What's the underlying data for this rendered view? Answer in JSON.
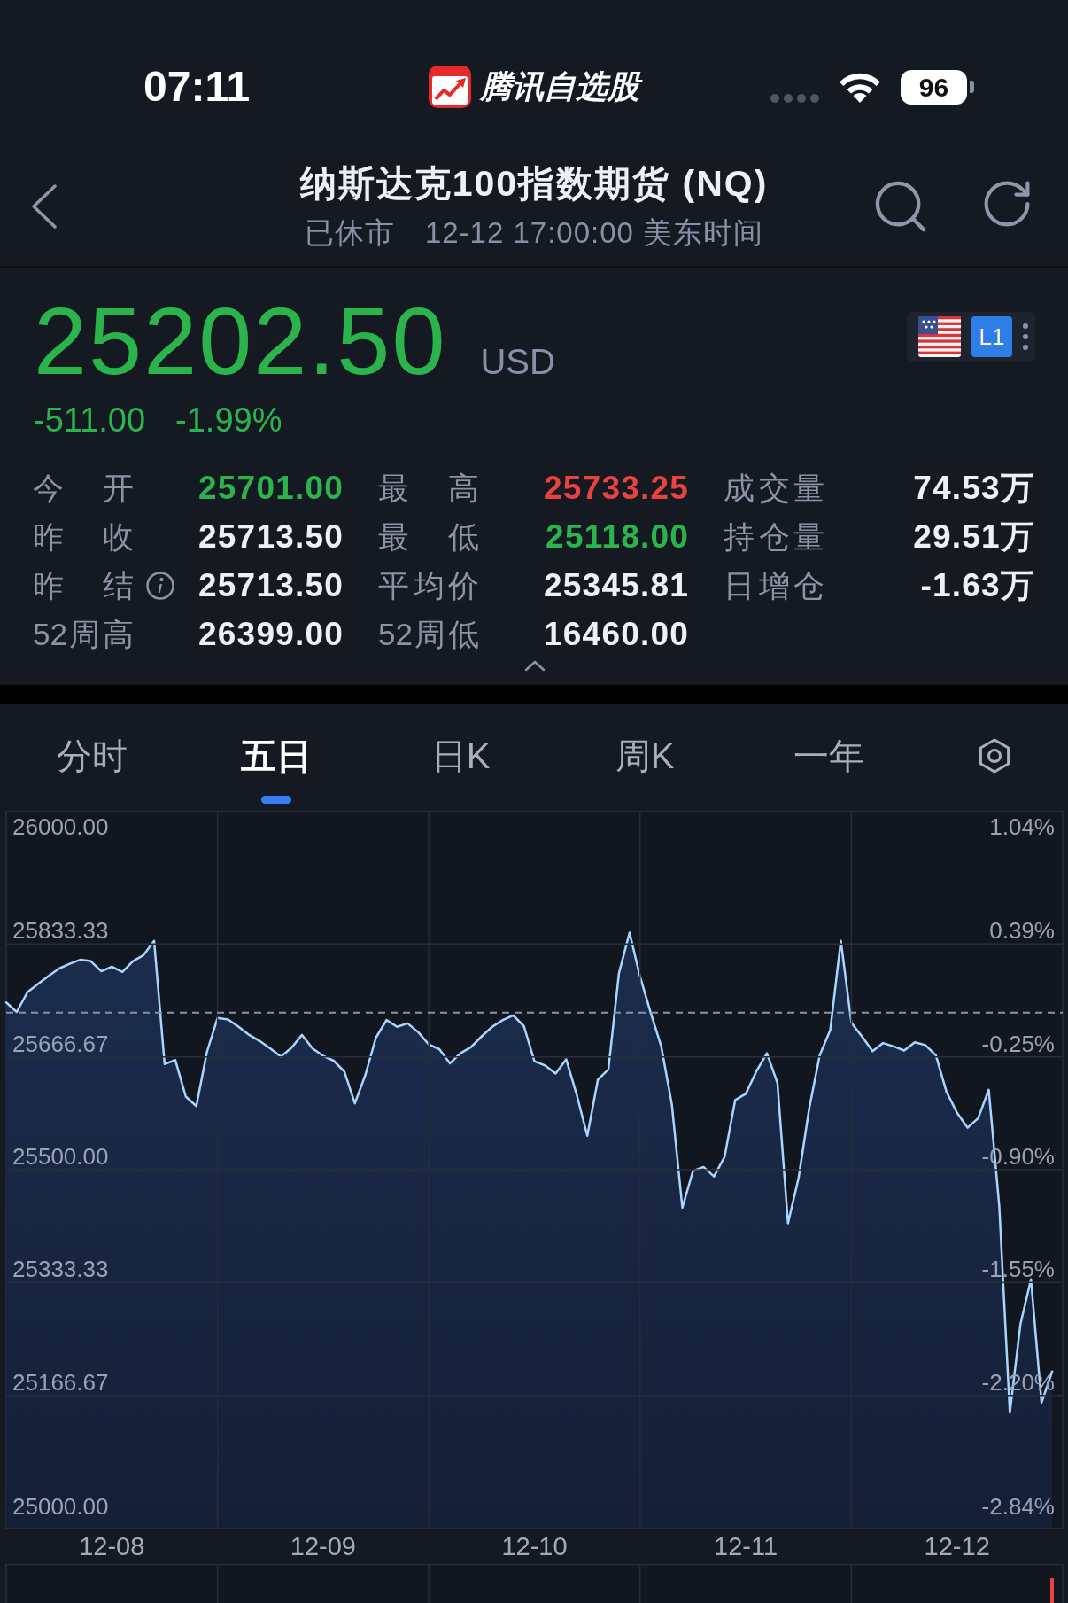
{
  "status_bar": {
    "time": "07:11",
    "app_name": "腾讯自选股",
    "battery": "96"
  },
  "header": {
    "title": "纳斯达克100指数期货 (NQ)",
    "market_status": "已休市",
    "timestamp": "12-12 17:00:00 美东时间"
  },
  "quote": {
    "price": "25202.50",
    "currency": "USD",
    "change": "-511.00",
    "change_percent": "-1.99%",
    "color": "#2cb44c",
    "level_badge": "L1"
  },
  "stats": [
    {
      "label": "今 开",
      "value": "25701.00",
      "color": "#2cb44c",
      "info": false
    },
    {
      "label": "最 高",
      "value": "25733.25",
      "color": "#e8433f",
      "info": false
    },
    {
      "label": "成交量",
      "value": "74.53万",
      "color": "#eef0f4",
      "info": false
    },
    {
      "label": "昨 收",
      "value": "25713.50",
      "color": "#eef0f4",
      "info": false
    },
    {
      "label": "最 低",
      "value": "25118.00",
      "color": "#2cb44c",
      "info": false
    },
    {
      "label": "持仓量",
      "value": "29.51万",
      "color": "#eef0f4",
      "info": false
    },
    {
      "label": "昨 结",
      "value": "25713.50",
      "color": "#eef0f4",
      "info": true
    },
    {
      "label": "平均价",
      "value": "25345.81",
      "color": "#eef0f4",
      "info": false
    },
    {
      "label": "日增仓",
      "value": "-1.63万",
      "color": "#eef0f4",
      "info": false
    },
    {
      "label": "52周高",
      "value": "26399.00",
      "color": "#eef0f4",
      "info": false
    },
    {
      "label": "52周低",
      "value": "16460.00",
      "color": "#eef0f4",
      "info": false
    }
  ],
  "tabs": [
    {
      "label": "分时",
      "selected": false
    },
    {
      "label": "五日",
      "selected": true
    },
    {
      "label": "日K",
      "selected": false
    },
    {
      "label": "周K",
      "selected": false
    },
    {
      "label": "一年",
      "selected": false
    }
  ],
  "chart": {
    "chart_data": {
      "type": "area",
      "grid": true,
      "categories": [
        null,
        null,
        null,
        null,
        null,
        null,
        null,
        null,
        null,
        null,
        "12-08",
        null,
        null,
        null,
        null,
        null,
        null,
        null,
        null,
        null,
        null,
        null,
        null,
        null,
        null,
        null,
        null,
        null,
        null,
        null,
        "12-09",
        null,
        null,
        null,
        null,
        null,
        null,
        null,
        null,
        null,
        null,
        null,
        null,
        null,
        null,
        null,
        null,
        null,
        null,
        null,
        "12-10",
        null,
        null,
        null,
        null,
        null,
        null,
        null,
        null,
        null,
        null,
        null,
        null,
        null,
        null,
        null,
        null,
        null,
        null,
        null,
        "12-11",
        null,
        null,
        null,
        null,
        null,
        null,
        null,
        null,
        null,
        null,
        null,
        null,
        null,
        null,
        null,
        null,
        null,
        null,
        null,
        "12-12",
        null,
        null,
        null,
        null,
        null,
        null,
        null,
        null,
        null
      ],
      "values": [
        25747,
        25733,
        25762,
        25774,
        25786,
        25797,
        25804,
        25810,
        25808,
        25793,
        25800,
        25792,
        25808,
        25817,
        25838,
        25656,
        25662,
        25608,
        25594,
        25674,
        25724,
        25722,
        25711,
        25699,
        25690,
        25679,
        25667,
        25680,
        25699,
        25679,
        25668,
        25661,
        25645,
        25598,
        25640,
        25695,
        25721,
        25711,
        25716,
        25703,
        25685,
        25678,
        25657,
        25672,
        25681,
        25697,
        25711,
        25721,
        25728,
        25712,
        25660,
        25654,
        25642,
        25663,
        25611,
        25550,
        25633,
        25648,
        25790,
        25850,
        25785,
        25732,
        25682,
        25597,
        25444,
        25498,
        25504,
        25490,
        25519,
        25603,
        25612,
        25645,
        25672,
        25628,
        25421,
        25488,
        25590,
        25669,
        25706,
        25838,
        25717,
        25697,
        25675,
        25687,
        25682,
        25676,
        25688,
        25684,
        25669,
        25615,
        25584,
        25562,
        25576,
        25618,
        25446,
        25141,
        25272,
        25338,
        25156,
        25202
      ],
      "ylim": [
        24970,
        26030
      ],
      "yticks": [
        {
          "value": 26000,
          "label": "26000.00"
        },
        {
          "value": 25833.33,
          "label": "25833.33"
        },
        {
          "value": 25666.67,
          "label": "25666.67"
        },
        {
          "value": 25500,
          "label": "25500.00"
        },
        {
          "value": 25333.33,
          "label": "25333.33"
        },
        {
          "value": 25166.67,
          "label": "25166.67"
        },
        {
          "value": 25000,
          "label": "25000.00"
        }
      ],
      "ref_lines": [
        {
          "axis": "y",
          "value": 25732
        }
      ]
    },
    "percent_labels": [
      "1.04%",
      "0.39%",
      "-0.25%",
      "-0.90%",
      "-1.55%",
      "-2.20%",
      "-2.84%"
    ]
  }
}
